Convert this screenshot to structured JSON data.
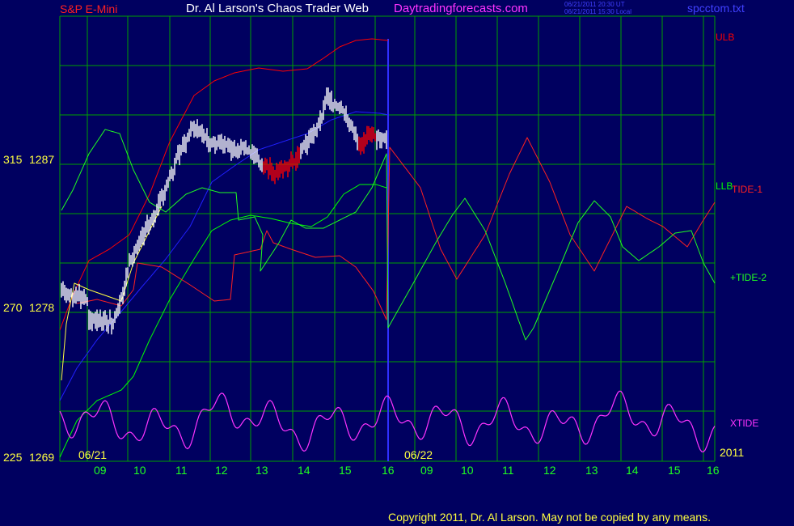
{
  "header": {
    "symbol": "S&P E-Mini",
    "title": "Dr. Al Larson's Chaos Trader Web",
    "site": "Daytradingforecasts.com",
    "stamp_ut": "06/21/2011 20:30 UT",
    "stamp_local": "06/21/2011 15:30 Local",
    "filename": "spcctom.txt"
  },
  "footer": {
    "copyright": "Copyright 2011, Dr. Al Larson. May not be copied by any means."
  },
  "colors": {
    "background": "#000060",
    "grid": "#00a000",
    "ulb": "#ff0000",
    "llb": "#00ff00",
    "tide1": "#ff2020",
    "tide2": "#20ff20",
    "xtide": "#ff33ff",
    "ema": "#2020ff",
    "price_up": "#ffffff",
    "price_down": "#ff0000",
    "yellow_label": "#ffff40",
    "date_label": "#20ff20"
  },
  "chart_data": {
    "type": "line",
    "x_labels": [
      "09",
      "10",
      "11",
      "12",
      "13",
      "14",
      "15",
      "16",
      "09",
      "10",
      "11",
      "12",
      "13",
      "14",
      "15",
      "16"
    ],
    "date_labels": [
      "06/21",
      "06/22"
    ],
    "year_label": "2011",
    "y_labels": [
      {
        "index": "315",
        "price": "1287"
      },
      {
        "index": "270",
        "price": "1278"
      },
      {
        "index": "225",
        "price": "1269"
      }
    ],
    "ylim": [
      1269,
      1287
    ],
    "legend": {
      "ulb": "ULB",
      "llb": "LLB",
      "tide1": "TIDE-1",
      "tide2": "+TIDE-2",
      "xtide": "XTIDE"
    },
    "grid": true,
    "price_hours": [
      8.0,
      8.3,
      8.6,
      9.0,
      9.3,
      9.6,
      9.75,
      10.0,
      10.3,
      10.6,
      10.9,
      11.2,
      11.55,
      11.8,
      12.0,
      12.3,
      12.5,
      12.75,
      13.0,
      13.25,
      13.5,
      13.75,
      14.0,
      14.3,
      14.6,
      14.75,
      15.0,
      15.2,
      15.4,
      15.5,
      15.6,
      15.75,
      15.9,
      16.0
    ],
    "price_closes": [
      1279.3,
      1278.5,
      1278.0,
      1277.7,
      1277.4,
      1277.4,
      1278.0,
      1280.8,
      1282.6,
      1283.8,
      1285.6,
      1287.6,
      1289.3,
      1288.7,
      1288.2,
      1288.3,
      1287.9,
      1287.9,
      1287.5,
      1286.9,
      1286.5,
      1286.7,
      1287.3,
      1288.3,
      1289.6,
      1291.1,
      1290.4,
      1290.0,
      1289.1,
      1288.3,
      1288.1,
      1288.9,
      1288.7,
      1288.5
    ],
    "series_notes": [
      "ULB",
      "LLB",
      "TIDE-1",
      "+TIDE-2",
      "XTIDE"
    ]
  }
}
